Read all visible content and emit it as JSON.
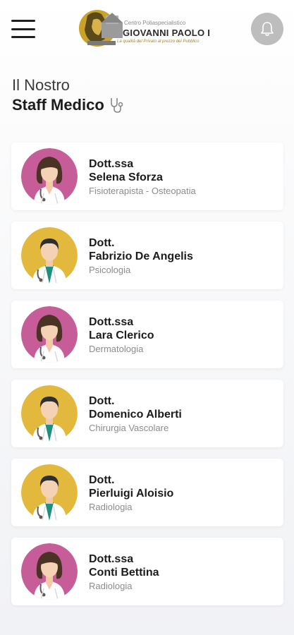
{
  "header": {
    "menu_icon": "hamburger-menu-icon",
    "logo": {
      "line1": "Centro Poliaspecialistico",
      "line2": "GIOVANNI PAOLO I",
      "line3": "La qualità del Privato al prezzo del Pubblico"
    },
    "bell_icon": "bell-icon"
  },
  "page": {
    "title_line1": "Il Nostro",
    "title_line2": "Staff Medico",
    "title_icon": "stethoscope-icon"
  },
  "colors": {
    "female_avatar_bg": "#c65c98",
    "male_avatar_bg": "#e3b93d"
  },
  "doctors": [
    {
      "title": "Dott.ssa",
      "name": "Selena Sforza",
      "specialty": "Fisioterapista - Osteopatia",
      "gender": "female"
    },
    {
      "title": "Dott.",
      "name": "Fabrizio De Angelis",
      "specialty": "Psicologia",
      "gender": "male"
    },
    {
      "title": "Dott.ssa",
      "name": "Lara Clerico",
      "specialty": "Dermatologia",
      "gender": "female"
    },
    {
      "title": "Dott.",
      "name": "Domenico Alberti",
      "specialty": "Chirurgia Vascolare",
      "gender": "male"
    },
    {
      "title": "Dott.",
      "name": "Pierluigi Aloisio",
      "specialty": "Radiologia",
      "gender": "male"
    },
    {
      "title": "Dott.ssa",
      "name": "Conti Bettina",
      "specialty": "Radiologia",
      "gender": "female"
    }
  ]
}
